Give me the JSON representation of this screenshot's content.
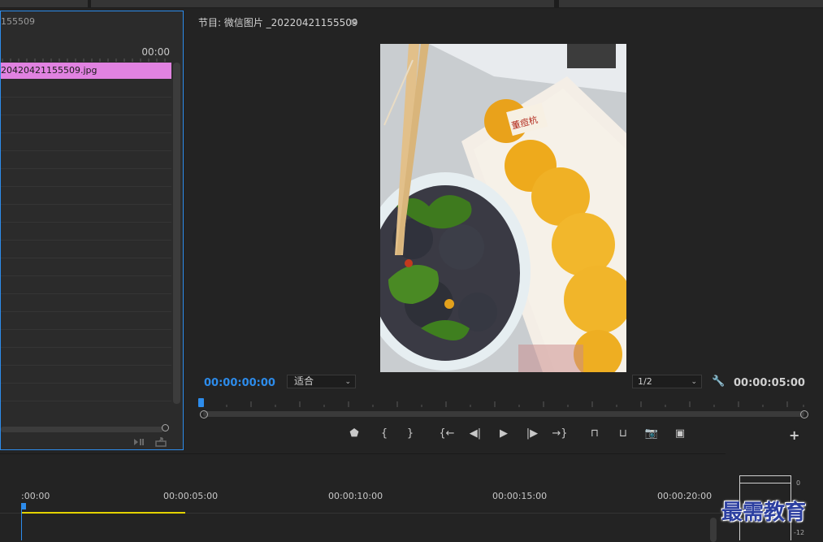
{
  "source_panel": {
    "tab_title": "155509",
    "timecode_end": "00:00",
    "clip_name": "20420421155509.jpg"
  },
  "program_monitor": {
    "title": "节目: 微信图片 _20220421155509",
    "menu_icon": "hamburger-icon",
    "current_timecode": "00:00:00:00",
    "fit_label": "适合",
    "resolution_label": "1/2",
    "duration": "00:00:05:00",
    "preview_stamp_text": "董痘杭",
    "transport": [
      {
        "name": "add-marker-button",
        "glyph": "⬟",
        "icon": "marker-icon"
      },
      {
        "name": "mark-in-button",
        "glyph": "{",
        "icon": "mark-in-icon"
      },
      {
        "name": "mark-out-button",
        "glyph": "}",
        "icon": "mark-out-icon"
      },
      {
        "name": "go-to-in-button",
        "glyph": "{←",
        "icon": "go-to-in-icon"
      },
      {
        "name": "step-back-button",
        "glyph": "◀|",
        "icon": "step-back-icon"
      },
      {
        "name": "play-button",
        "glyph": "▶",
        "icon": "play-icon"
      },
      {
        "name": "step-forward-button",
        "glyph": "|▶",
        "icon": "step-forward-icon"
      },
      {
        "name": "go-to-out-button",
        "glyph": "→}",
        "icon": "go-to-out-icon"
      },
      {
        "name": "lift-button",
        "glyph": "⊓",
        "icon": "lift-icon"
      },
      {
        "name": "extract-button",
        "glyph": "⊔",
        "icon": "extract-icon"
      },
      {
        "name": "export-frame-button",
        "glyph": "📷",
        "icon": "camera-icon"
      },
      {
        "name": "comparison-view-button",
        "glyph": "▣",
        "icon": "comparison-icon"
      }
    ],
    "add_button_label": "+"
  },
  "timeline": {
    "timecodes": [
      ":00:00",
      "00:00:05:00",
      "00:00:10:00",
      "00:00:15:00",
      "00:00:20:00"
    ]
  },
  "audio_meter": {
    "labels": [
      "0",
      "-12"
    ]
  },
  "watermark": "最需教育",
  "colors": {
    "accent_blue": "#2d8ceb",
    "clip_pink": "#e182e1",
    "work_area_yellow": "#e3d200"
  }
}
